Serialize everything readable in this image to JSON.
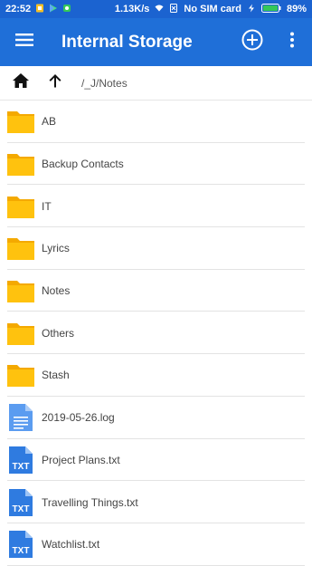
{
  "status_bar": {
    "time": "22:52",
    "network_speed": "1.13K/s",
    "sim_status": "No SIM card",
    "battery": "89%"
  },
  "app_bar": {
    "title": "Internal Storage",
    "menu_icon": "hamburger-menu-icon",
    "add_icon": "add-circle-icon",
    "more_icon": "more-vert-icon"
  },
  "path_bar": {
    "path": "/_J/Notes",
    "home_icon": "home-icon",
    "up_icon": "arrow-up-icon"
  },
  "colors": {
    "app_bar": "#1f6fd8",
    "status_bar": "#1b63d0",
    "folder": "#ffc20e",
    "txt_file": "#2f7be0",
    "log_file": "#5b9cf0"
  },
  "files": [
    {
      "name": "AB",
      "type": "folder"
    },
    {
      "name": "Backup Contacts",
      "type": "folder"
    },
    {
      "name": "IT",
      "type": "folder"
    },
    {
      "name": "Lyrics",
      "type": "folder"
    },
    {
      "name": "Notes",
      "type": "folder"
    },
    {
      "name": "Others",
      "type": "folder"
    },
    {
      "name": "Stash",
      "type": "folder"
    },
    {
      "name": "2019-05-26.log",
      "type": "log"
    },
    {
      "name": "Project Plans.txt",
      "type": "txt",
      "badge": "TXT"
    },
    {
      "name": "Travelling Things.txt",
      "type": "txt",
      "badge": "TXT"
    },
    {
      "name": "Watchlist.txt",
      "type": "txt",
      "badge": "TXT"
    }
  ]
}
